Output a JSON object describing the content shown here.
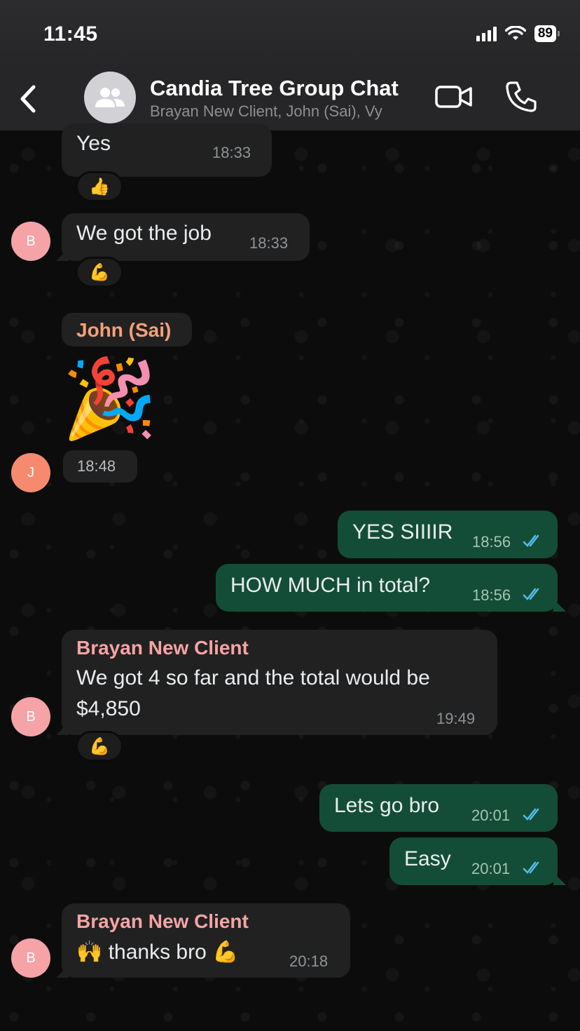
{
  "status_bar": {
    "time": "11:45",
    "battery": "89"
  },
  "header": {
    "title": "Candia Tree Group Chat",
    "subtitle": "Brayan New Client, John (Sai), Vy"
  },
  "messages": [
    {
      "text": "Yes",
      "time": "18:33",
      "reaction": "👍"
    },
    {
      "text": "We got the job",
      "time": "18:33",
      "reaction": "💪",
      "avatar": "B"
    },
    {
      "sender": "John (Sai)",
      "sticker": "🎉",
      "time": "18:48",
      "avatar": "J"
    },
    {
      "text": "YES SIIIIR",
      "time": "18:56"
    },
    {
      "text": "HOW MUCH in total?",
      "time": "18:56"
    },
    {
      "sender": "Brayan New Client",
      "line1": "We got 4 so far and the total would be",
      "line2": "$4,850",
      "time": "19:49",
      "reaction": "💪",
      "avatar": "B"
    },
    {
      "text": "Lets go bro",
      "time": "20:01"
    },
    {
      "text": "Easy",
      "time": "20:01"
    },
    {
      "sender": "Brayan New Client",
      "text": "🙌  thanks bro 💪",
      "time": "20:18",
      "avatar": "B"
    }
  ],
  "colors": {
    "incoming_bubble": "#212121",
    "outgoing_bubble": "#144d37",
    "sender_john": "#f7a07a",
    "sender_brayan": "#f5a3a6",
    "read_ticks": "#53bdeb"
  }
}
